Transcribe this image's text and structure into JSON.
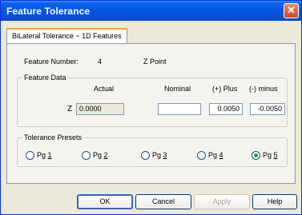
{
  "window": {
    "title": "Feature Tolerance",
    "close_glyph": "✕"
  },
  "tab": {
    "label": "BiLateral Tolerance ~ 1D Features"
  },
  "feature": {
    "number_label": "Feature Number:",
    "number_value": "4",
    "name": "Z Point"
  },
  "feature_data": {
    "group_label": "Feature Data",
    "headers": {
      "actual": "Actual",
      "nominal": "Nominal",
      "plus": "(+) Plus",
      "minus": "(-) minus"
    },
    "axis": "Z",
    "actual_value": "0.0000",
    "nominal_value": "",
    "plus_value": "0.0050",
    "minus_value": "-0.0050"
  },
  "presets": {
    "group_label": "Tolerance Presets",
    "items": [
      {
        "prefix": "Pg ",
        "key": "1",
        "selected": false
      },
      {
        "prefix": "Pg ",
        "key": "2",
        "selected": false
      },
      {
        "prefix": "Pg ",
        "key": "3",
        "selected": false
      },
      {
        "prefix": "Pg ",
        "key": "4",
        "selected": false
      },
      {
        "prefix": "Pg ",
        "key": "5",
        "selected": true
      }
    ]
  },
  "buttons": {
    "ok": "OK",
    "cancel": "Cancel",
    "apply": "Apply",
    "help": "Help"
  },
  "colors": {
    "titlebar": "#0554e3",
    "selected_radio": "#21a121",
    "tab_highlight": "#f1a63b"
  }
}
